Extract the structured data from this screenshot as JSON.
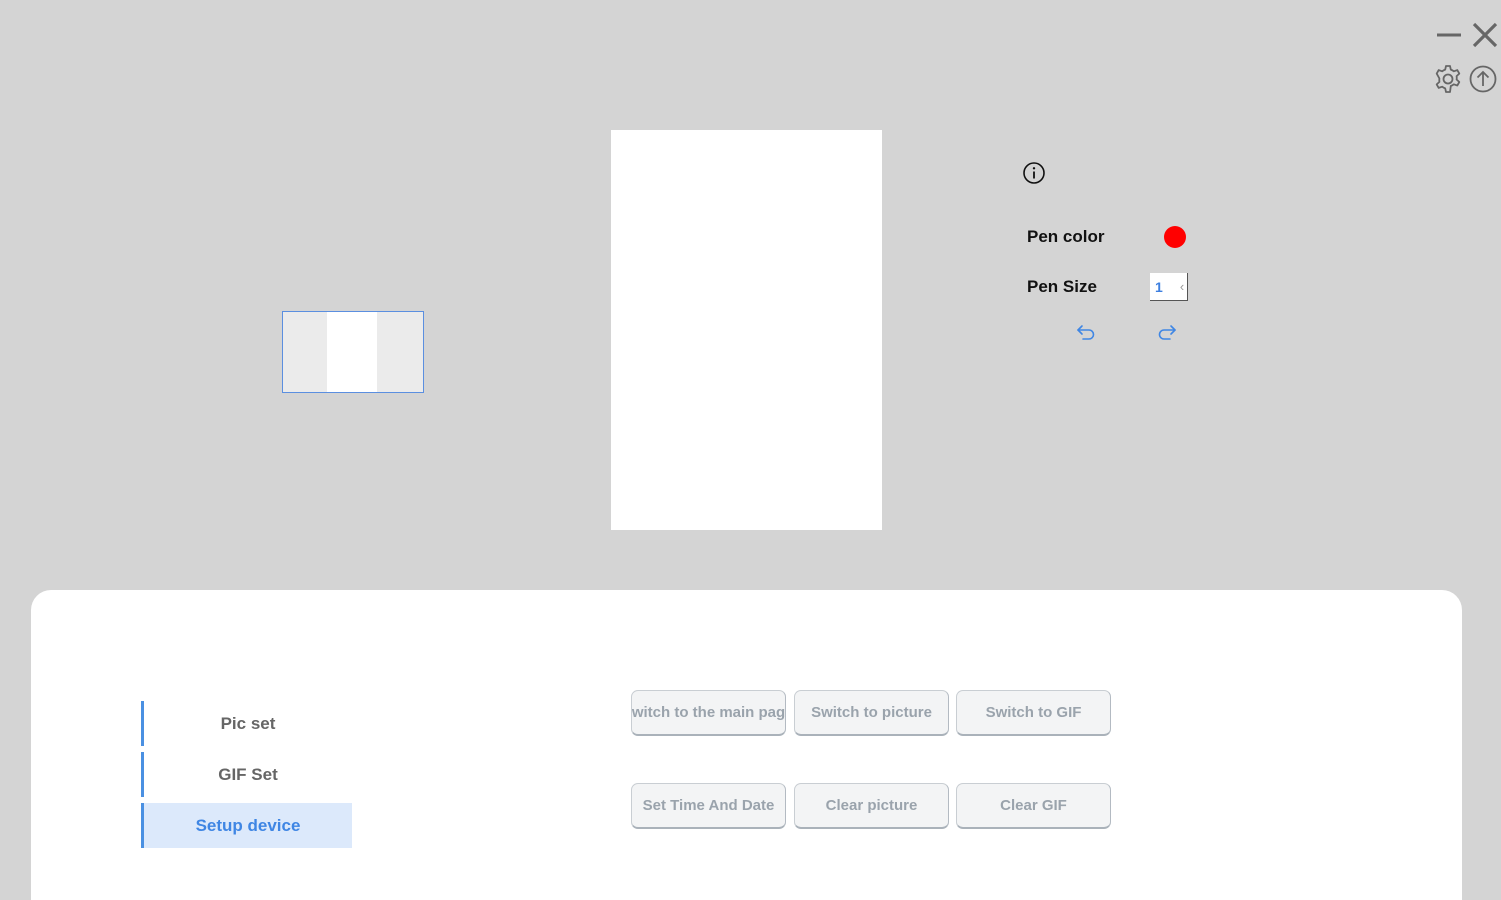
{
  "window": {
    "minimize_icon": "minimize-icon",
    "close_icon": "close-icon",
    "settings_icon": "gear-icon",
    "upload_icon": "upload-icon"
  },
  "editor": {
    "info_icon": "info-icon",
    "pen_color_label": "Pen color",
    "pen_color_value": "#ff0000",
    "pen_size_label": "Pen Size",
    "pen_size_value": "1",
    "undo_icon": "undo-icon",
    "redo_icon": "redo-icon"
  },
  "nav": {
    "items": [
      {
        "label": "Pic set"
      },
      {
        "label": "GIF Set"
      },
      {
        "label": "Setup device"
      }
    ],
    "active": "Setup device"
  },
  "actions": {
    "switch_main": "witch to the main pag",
    "switch_picture": "Switch to picture",
    "switch_gif": "Switch to GIF",
    "set_time_date": "Set Time And Date",
    "clear_picture": "Clear picture",
    "clear_gif": "Clear GIF"
  },
  "colors": {
    "background": "#d4d4d4",
    "accent": "#4a90e2",
    "active_nav_bg": "#dce9fb",
    "pen_color": "#ff0000"
  }
}
